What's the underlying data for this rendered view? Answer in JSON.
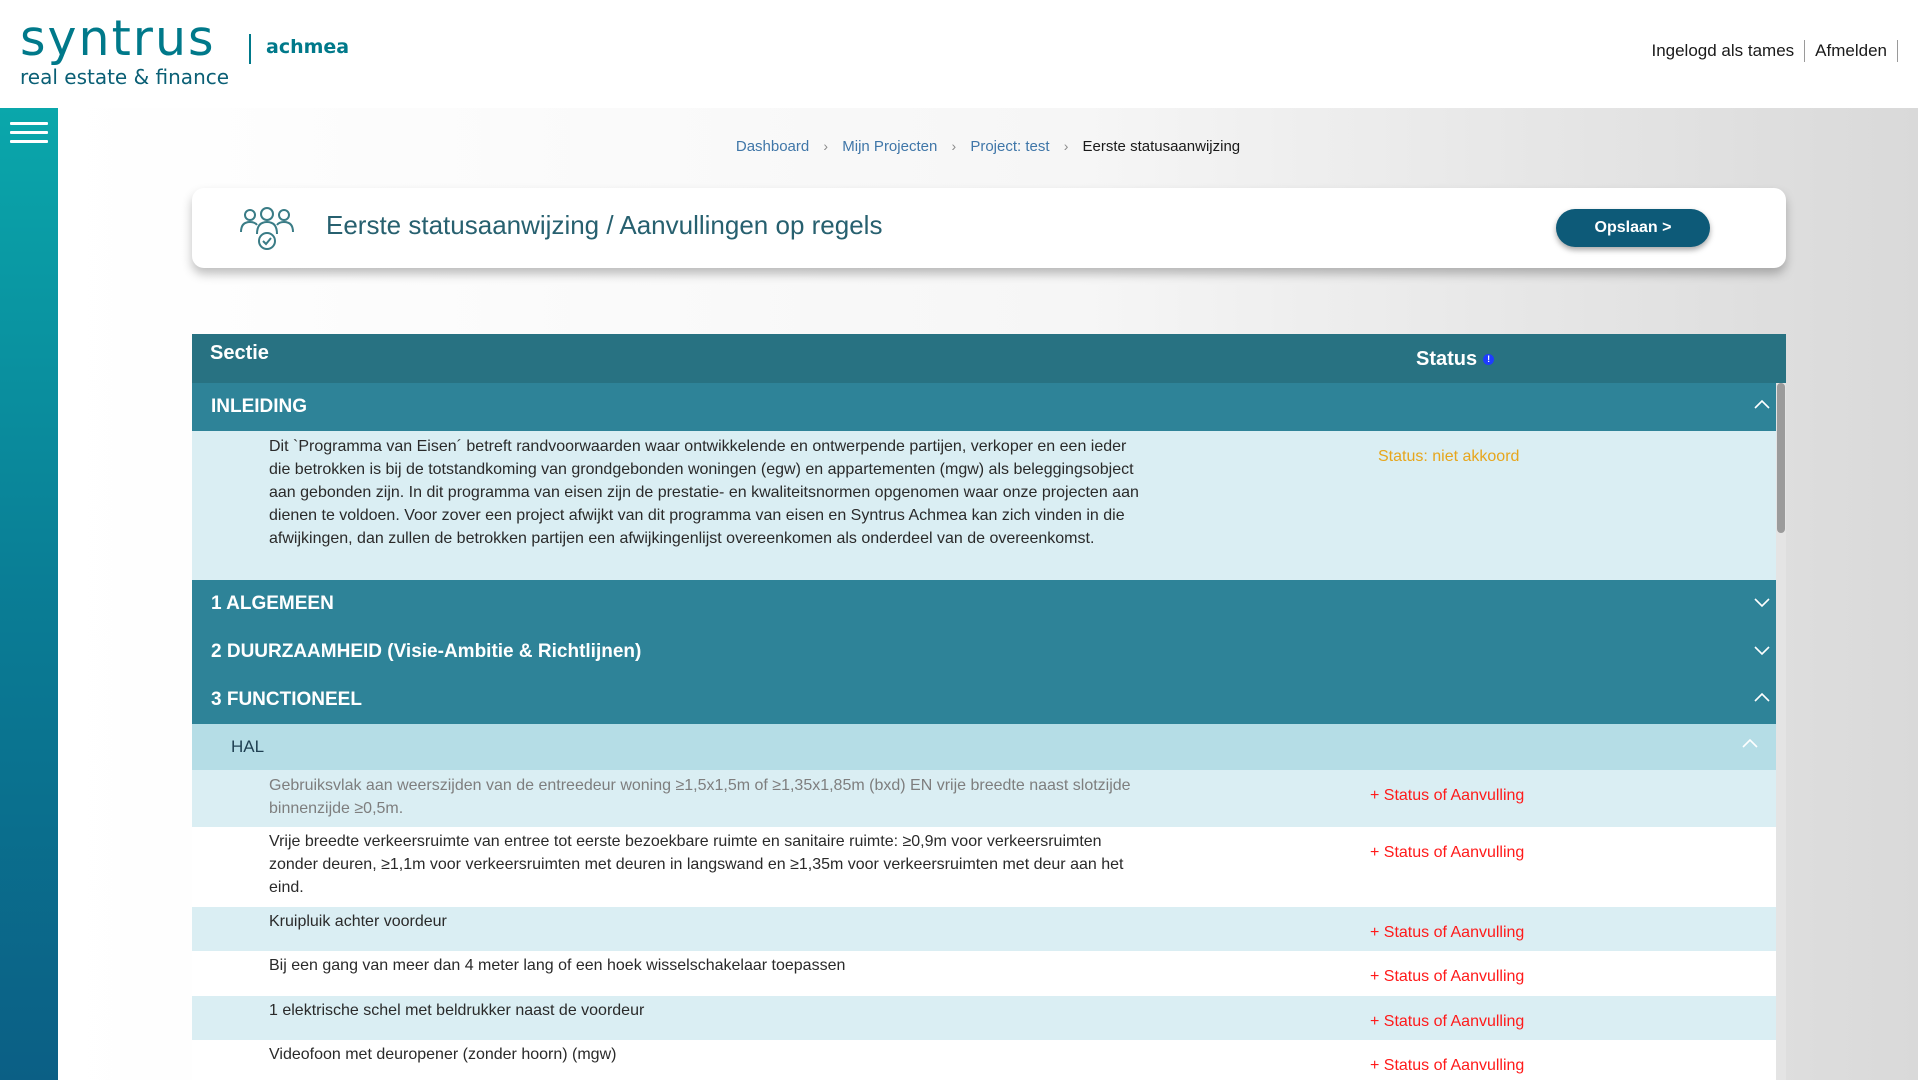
{
  "logo": {
    "main": "syntrus",
    "brand": "achmea",
    "sub": "real estate & finance"
  },
  "top_links": {
    "logged_in": "Ingelogd als tames",
    "logout": "Afmelden"
  },
  "breadcrumb": {
    "items": [
      "Dashboard",
      "Mijn Projecten",
      "Project: test"
    ],
    "current": "Eerste statusaanwijzing"
  },
  "title_card": {
    "title": "Eerste statusaanwijzing / Aanvullingen op regels",
    "save_button": "Opslaan >"
  },
  "table": {
    "headers": {
      "section": "Sectie",
      "status": "Status"
    },
    "sections": [
      {
        "label": "INLEIDING",
        "expanded": true,
        "items": [
          {
            "text": "Dit `Programma van Eisen´ betreft randvoorwaarden waar ontwikkelende en ontwerpende partijen, verkoper en een ieder die betrokken is bij de totstandkoming van grondgebonden woningen (egw) en appartementen (mgw) als beleggingsobject aan gebonden zijn. In dit programma van eisen zijn de prestatie- en kwaliteitsnormen opgenomen waar onze projecten aan dienen te voldoen. Voor zover een project afwijkt van dit programma van eisen en Syntrus Achmea kan zich vinden in die afwijkingen, dan zullen de betrokken partijen een afwijkingenlijst overeenkomen als onderdeel van de overeenkomst.",
            "status": "Status: niet akkoord"
          }
        ]
      },
      {
        "label": "1 ALGEMEEN",
        "expanded": false
      },
      {
        "label": "2 DUURZAAMHEID (Visie-Ambitie & Richtlijnen)",
        "expanded": false
      },
      {
        "label": "3 FUNCTIONEEL",
        "expanded": true,
        "subsections": [
          {
            "label": "HAL",
            "items": [
              {
                "text": "Gebruiksvlak aan weerszijden van de entreedeur woning ≥1,5x1,5m of ≥1,35x1,85m (bxd) EN vrije breedte naast slotzijde binnenzijde ≥0,5m.",
                "status": "+ Status of Aanvulling"
              },
              {
                "text": "Vrije breedte verkeersruimte van entree tot eerste bezoekbare ruimte en sanitaire ruimte: ≥0,9m voor verkeersruimten zonder deuren, ≥1,1m voor verkeersruimten met deuren in langswand en ≥1,35m voor verkeersruimten met deur aan het eind.",
                "status": "+ Status of Aanvulling"
              },
              {
                "text": "Kruipluik achter voordeur",
                "status": "+ Status of Aanvulling"
              },
              {
                "text": "Bij een gang van meer dan 4 meter lang of een hoek wisselschakelaar toepassen",
                "status": "+ Status of Aanvulling"
              },
              {
                "text": "1 elektrische schel met beldrukker naast de voordeur",
                "status": "+ Status of Aanvulling"
              },
              {
                "text": "Videofoon met deuropener (zonder hoorn) (mgw)",
                "status": "+ Status of Aanvulling"
              }
            ]
          }
        ]
      }
    ]
  },
  "colors": {
    "brand_teal": "#00798a",
    "header_bar": "#287282",
    "section_bar": "#2e8398",
    "subsection_bar": "#b5dde6",
    "alt_row": "#daeef3",
    "status_red": "#ff1a1a",
    "status_orange": "#e7a61c",
    "save_button": "#0d5a78"
  },
  "icons": {
    "menu": "hamburger-menu-icon",
    "title": "people-check-icon",
    "breadcrumb_separator": "chevron-right-icon",
    "expanded": "chevron-up-icon",
    "collapsed": "chevron-down-icon",
    "status_info": "info-icon"
  }
}
